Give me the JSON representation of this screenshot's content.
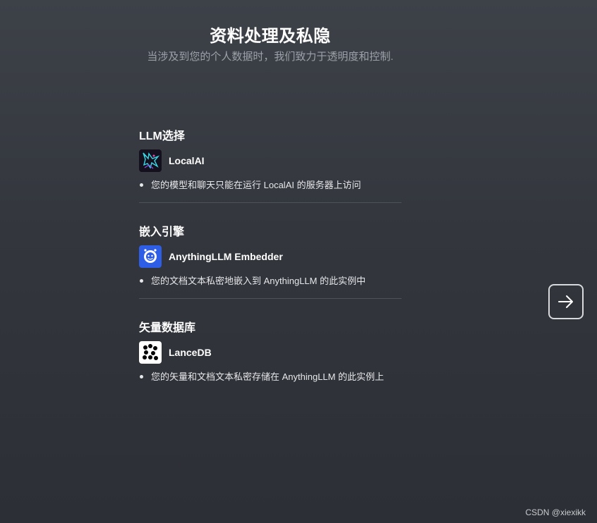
{
  "header": {
    "title": "资料处理及私隐",
    "subtitle": "当涉及到您的个人数据时，我们致力于透明度和控制."
  },
  "sections": [
    {
      "title": "LLM选择",
      "provider": "LocalAI",
      "icon": "localai-logo-icon",
      "description": "您的模型和聊天只能在运行 LocalAI 的服务器上访问"
    },
    {
      "title": "嵌入引擎",
      "provider": "AnythingLLM Embedder",
      "icon": "anythingllm-logo-icon",
      "description": "您的文档文本私密地嵌入到 AnythingLLM 的此实例中"
    },
    {
      "title": "矢量数据库",
      "provider": "LanceDB",
      "icon": "lancedb-logo-icon",
      "description": "您的矢量和文档文本私密存储在 AnythingLLM 的此实例上"
    }
  ],
  "next_button": {
    "icon": "arrow-right-icon"
  },
  "watermark": "CSDN @xiexikk",
  "colors": {
    "background_top": "#3d4148",
    "background_bottom": "#2c2f35",
    "subtitle": "#9ca0a8",
    "divider": "#4e525a",
    "anythingllm_blue": "#2e5de6"
  }
}
